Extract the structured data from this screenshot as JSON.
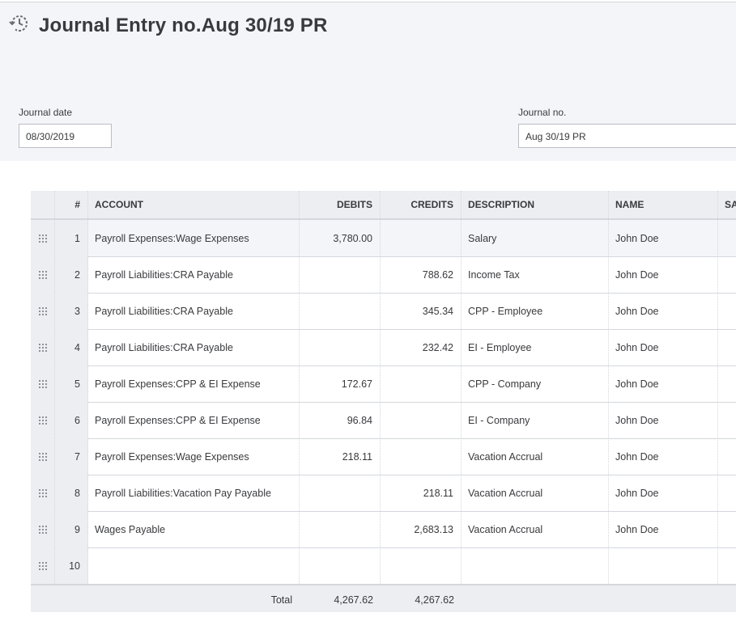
{
  "page": {
    "title": "Journal Entry no.Aug 30/19 PR"
  },
  "form": {
    "journal_date_label": "Journal date",
    "journal_date_value": "08/30/2019",
    "journal_no_label": "Journal no.",
    "journal_no_value": "Aug 30/19 PR"
  },
  "table": {
    "headers": {
      "num": "#",
      "account": "ACCOUNT",
      "debits": "DEBITS",
      "credits": "CREDITS",
      "description": "DESCRIPTION",
      "name": "NAME",
      "sales_tax": "SA"
    },
    "rows": [
      {
        "num": "1",
        "account": "Payroll Expenses:Wage Expenses",
        "debits": "3,780.00",
        "credits": "",
        "description": "Salary",
        "name": "John Doe"
      },
      {
        "num": "2",
        "account": "Payroll Liabilities:CRA Payable",
        "debits": "",
        "credits": "788.62",
        "description": "Income Tax",
        "name": "John Doe"
      },
      {
        "num": "3",
        "account": "Payroll Liabilities:CRA Payable",
        "debits": "",
        "credits": "345.34",
        "description": "CPP - Employee",
        "name": "John Doe"
      },
      {
        "num": "4",
        "account": "Payroll Liabilities:CRA Payable",
        "debits": "",
        "credits": "232.42",
        "description": "EI - Employee",
        "name": "John Doe"
      },
      {
        "num": "5",
        "account": "Payroll Expenses:CPP & EI Expense",
        "debits": "172.67",
        "credits": "",
        "description": "CPP - Company",
        "name": "John Doe"
      },
      {
        "num": "6",
        "account": "Payroll Expenses:CPP & EI Expense",
        "debits": "96.84",
        "credits": "",
        "description": "EI - Company",
        "name": "John Doe"
      },
      {
        "num": "7",
        "account": "Payroll Expenses:Wage Expenses",
        "debits": "218.11",
        "credits": "",
        "description": "Vacation Accrual",
        "name": "John Doe"
      },
      {
        "num": "8",
        "account": "Payroll Liabilities:Vacation Pay Payable",
        "debits": "",
        "credits": "218.11",
        "description": "Vacation Accrual",
        "name": "John Doe"
      },
      {
        "num": "9",
        "account": "Wages Payable",
        "debits": "",
        "credits": "2,683.13",
        "description": "Vacation Accrual",
        "name": "John Doe"
      },
      {
        "num": "10",
        "account": "",
        "debits": "",
        "credits": "",
        "description": "",
        "name": ""
      }
    ],
    "total": {
      "label": "Total",
      "debits": "4,267.62",
      "credits": "4,267.62"
    }
  },
  "icons": {
    "title_icon": "recurring-history-icon",
    "row_handle": "drag-handle-icon"
  },
  "colors": {
    "header_bg": "#f4f5f8",
    "table_header_bg": "#eceef1",
    "text": "#393a3d",
    "border": "#d4d7dc"
  }
}
